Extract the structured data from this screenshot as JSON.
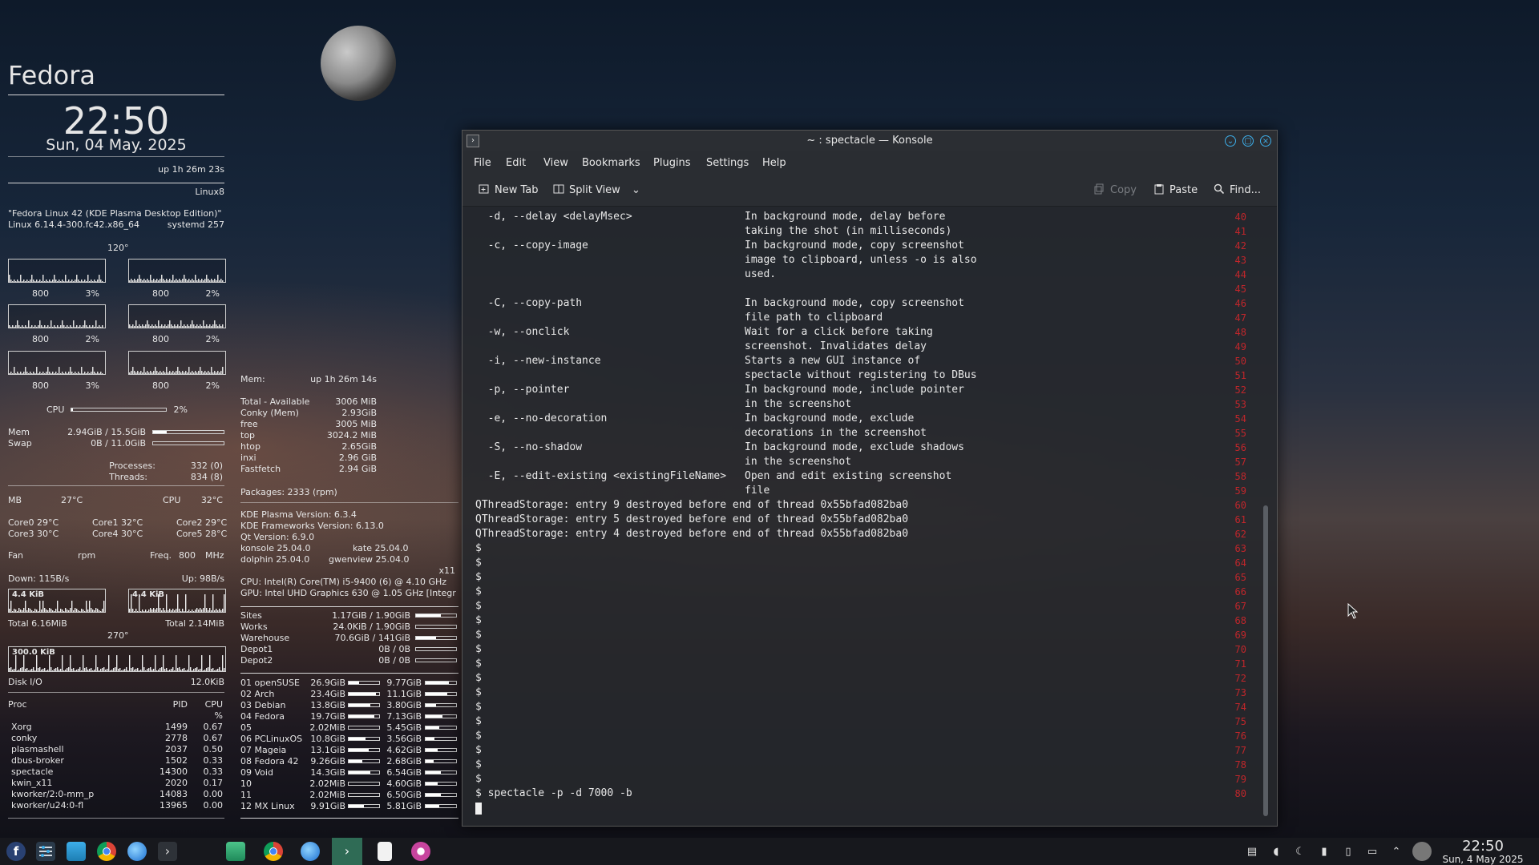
{
  "conky": {
    "distro": "Fedora",
    "time": "22:50",
    "date": "Sun, 04 May. 2025",
    "uptime": "up  1h 26m 23s",
    "kernel_tag": "Linux8",
    "os_name": "\"Fedora Linux 42 (KDE Plasma Desktop Edition)\"",
    "kernel": "Linux 6.14.4-300.fc42.x86_64",
    "systemd": "systemd 257",
    "angle_top": "120°",
    "cores": [
      {
        "freq": "800",
        "load": "3%"
      },
      {
        "freq": "800",
        "load": "2%"
      },
      {
        "freq": "800",
        "load": "2%"
      },
      {
        "freq": "800",
        "load": "2%"
      },
      {
        "freq": "800",
        "load": "3%"
      },
      {
        "freq": "800",
        "load": "2%"
      }
    ],
    "cpu_label": "CPU",
    "cpu_total": "2%",
    "cpu_fraction": 0.02,
    "mem_label": "Mem",
    "mem_value": "2.94GiB / 15.5GiB",
    "mem_fraction": 0.19,
    "swap_label": "Swap",
    "swap_value": "0B / 11.0GiB",
    "swap_fraction": 0.0,
    "processes_label": "Processes:",
    "processes": "332 (0)",
    "threads_label": "Threads:",
    "threads": "834 (8)",
    "mb_label": "MB",
    "mb_temp": "27°C",
    "cpu_temp_label": "CPU",
    "cpu_temp": "32°C",
    "core_temps": [
      [
        "Core0",
        "29°C"
      ],
      [
        "Core1",
        "32°C"
      ],
      [
        "Core2",
        "29°C"
      ],
      [
        "Core3",
        "30°C"
      ],
      [
        "Core4",
        "30°C"
      ],
      [
        "Core5",
        "28°C"
      ]
    ],
    "fan_label": "Fan",
    "fan_unit": "rpm",
    "freq_label": "Freq.",
    "freq_value": "800",
    "freq_unit": "MHz",
    "down": "Down: 115B/s",
    "up": "Up: 98B/s",
    "net_scale_left": "4.4 KiB",
    "net_scale_right": "4.4 KiB",
    "total_down": "Total 6.16MiB",
    "total_up": "Total 2.14MiB",
    "angle_bottom": "270°",
    "disk_scale": "300.0 KiB",
    "disk_label": "Disk I/O",
    "disk_value": "12.0KiB",
    "proc_header": [
      "Proc",
      "PID",
      "CPU",
      "%"
    ],
    "procs": [
      [
        "Xorg",
        "1499",
        "0.67"
      ],
      [
        "conky",
        "2778",
        "0.67"
      ],
      [
        "plasmashell",
        "2037",
        "0.50"
      ],
      [
        "dbus-broker",
        "1502",
        "0.33"
      ],
      [
        "spectacle",
        "14300",
        "0.33"
      ],
      [
        "kwin_x11",
        "2020",
        "0.17"
      ],
      [
        "kworker/2:0-mm_p",
        "14083",
        "0.00"
      ],
      [
        "kworker/u24:0-fl",
        "13965",
        "0.00"
      ]
    ],
    "mem_section": "Mem:",
    "mem_uptime": "up  1h 26m 14s",
    "mem_rows": [
      [
        "Total - Available",
        "3006 MiB"
      ],
      [
        "Conky (Mem)",
        "2.93GiB"
      ],
      [
        "free",
        "3005   MiB"
      ],
      [
        "top",
        "3024.2  MiB"
      ],
      [
        "htop",
        "2.65GiB"
      ],
      [
        "inxi",
        "2.96 GiB"
      ],
      [
        "Fastfetch",
        "2.94 GiB"
      ]
    ],
    "packages": "Packages: 2333 (rpm)",
    "versions": [
      "KDE Plasma Version: 6.3.4",
      "KDE Frameworks Version: 6.13.0",
      "Qt Version: 6.9.0"
    ],
    "apps_left": [
      "konsole 25.04.0",
      "dolphin 25.04.0"
    ],
    "apps_right": [
      "kate 25.04.0",
      "gwenview 25.04.0"
    ],
    "session": "x11",
    "cpu_model": "CPU: Intel(R) Core(TM) i5-9400 (6) @ 4.10 GHz",
    "gpu_model": "GPU: Intel UHD Graphics 630 @ 1.05 GHz [Integr",
    "disks_a": [
      {
        "name": "Sites",
        "value": "1.17GiB  /  1.90GiB",
        "fraction": 0.62
      },
      {
        "name": "Works",
        "value": "24.0KiB  /  1.90GiB",
        "fraction": 0.0
      },
      {
        "name": "Warehouse",
        "value": "70.6GiB  /  141GiB",
        "fraction": 0.5
      },
      {
        "name": "Depot1",
        "value": "0B  /  0B",
        "fraction": 0.0
      },
      {
        "name": "Depot2",
        "value": "0B  /  0B",
        "fraction": 0.0
      }
    ],
    "disks_b": [
      {
        "name": "01 openSUSE",
        "used": "26.9GiB",
        "uf": 0.35,
        "free": "9.77GiB",
        "ff": 0.75
      },
      {
        "name": "02 Arch",
        "used": "23.4GiB",
        "uf": 0.9,
        "free": "11.1GiB",
        "ff": 0.72
      },
      {
        "name": "03 Debian",
        "used": "13.8GiB",
        "uf": 0.7,
        "free": "3.80GiB",
        "ff": 0.35
      },
      {
        "name": "04 Fedora",
        "used": "19.7GiB",
        "uf": 0.85,
        "free": "7.13GiB",
        "ff": 0.55
      },
      {
        "name": "05",
        "used": "2.02MiB",
        "uf": 0.0,
        "free": "5.45GiB",
        "ff": 0.45
      },
      {
        "name": "06 PCLinuxOS",
        "used": "10.8GiB",
        "uf": 0.55,
        "free": "3.56GiB",
        "ff": 0.3
      },
      {
        "name": "07 Mageia",
        "used": "13.1GiB",
        "uf": 0.65,
        "free": "4.62GiB",
        "ff": 0.4
      },
      {
        "name": "08 Fedora 42",
        "used": "9.26GiB",
        "uf": 0.45,
        "free": "2.68GiB",
        "ff": 0.25
      },
      {
        "name": "09 Void",
        "used": "14.3GiB",
        "uf": 0.7,
        "free": "6.54GiB",
        "ff": 0.5
      },
      {
        "name": "10",
        "used": "2.02MiB",
        "uf": 0.0,
        "free": "4.60GiB",
        "ff": 0.4
      },
      {
        "name": "11",
        "used": "2.02MiB",
        "uf": 0.0,
        "free": "6.50GiB",
        "ff": 0.5
      },
      {
        "name": "12 MX Linux",
        "used": "9.91GiB",
        "uf": 0.5,
        "free": "5.81GiB",
        "ff": 0.45
      }
    ]
  },
  "konsole": {
    "title": "~ : spectacle — Konsole",
    "menu": [
      "File",
      "Edit",
      "View",
      "Bookmarks",
      "Plugins",
      "Settings",
      "Help"
    ],
    "toolbar": {
      "new_tab": "New Tab",
      "split_view": "Split View",
      "copy": "Copy",
      "paste": "Paste",
      "find": "Find..."
    },
    "options": [
      {
        "opt": "-d, --delay <delayMsec>",
        "desc": [
          "In background mode, delay before",
          "taking the shot (in milliseconds)"
        ]
      },
      {
        "opt": "-c, --copy-image",
        "desc": [
          "In background mode, copy screenshot",
          "image to clipboard, unless -o is also",
          "used."
        ]
      },
      {
        "opt": "-C, --copy-path",
        "desc": [
          "In background mode, copy screenshot",
          "file path to clipboard"
        ]
      },
      {
        "opt": "-w, --onclick",
        "desc": [
          "Wait for a click before taking",
          "screenshot. Invalidates delay"
        ]
      },
      {
        "opt": "-i, --new-instance",
        "desc": [
          "Starts a new GUI instance of",
          "spectacle without registering to DBus"
        ]
      },
      {
        "opt": "-p, --pointer",
        "desc": [
          "In background mode, include pointer",
          "in the screenshot"
        ]
      },
      {
        "opt": "-e, --no-decoration",
        "desc": [
          "In background mode, exclude",
          "decorations in the screenshot"
        ]
      },
      {
        "opt": "-S, --no-shadow",
        "desc": [
          "In background mode, exclude shadows",
          "in the screenshot"
        ]
      },
      {
        "opt": "-E, --edit-existing <existingFileName>",
        "desc": [
          "Open and edit existing screenshot",
          "file"
        ]
      }
    ],
    "warnings": [
      "QThreadStorage: entry 9 destroyed before end of thread 0x55bfad082ba0",
      "QThreadStorage: entry 5 destroyed before end of thread 0x55bfad082ba0",
      "QThreadStorage: entry 4 destroyed before end of thread 0x55bfad082ba0"
    ],
    "prompt": "$",
    "empty_prompts": 17,
    "last_command": "$ spectacle -p -d 7000 -b",
    "line_numbers_start": 40,
    "line_numbers_end": 80
  },
  "taskbar": {
    "clock_time": "22:50",
    "clock_date": "Sun, 4 May 2025",
    "launchers": [
      "fedora-icon",
      "settings-icon",
      "files-icon",
      "chrome-icon",
      "thunderbird-icon",
      "terminal-icon"
    ],
    "tasks": [
      "dolphin-task-icon",
      "chrome-task-icon",
      "thunderbird-task-icon",
      "konsole-task-icon",
      "kate-task-icon",
      "spectacle-task-icon"
    ]
  },
  "colors": {
    "accent": "#3daee9",
    "line_number": "#c0262b"
  }
}
